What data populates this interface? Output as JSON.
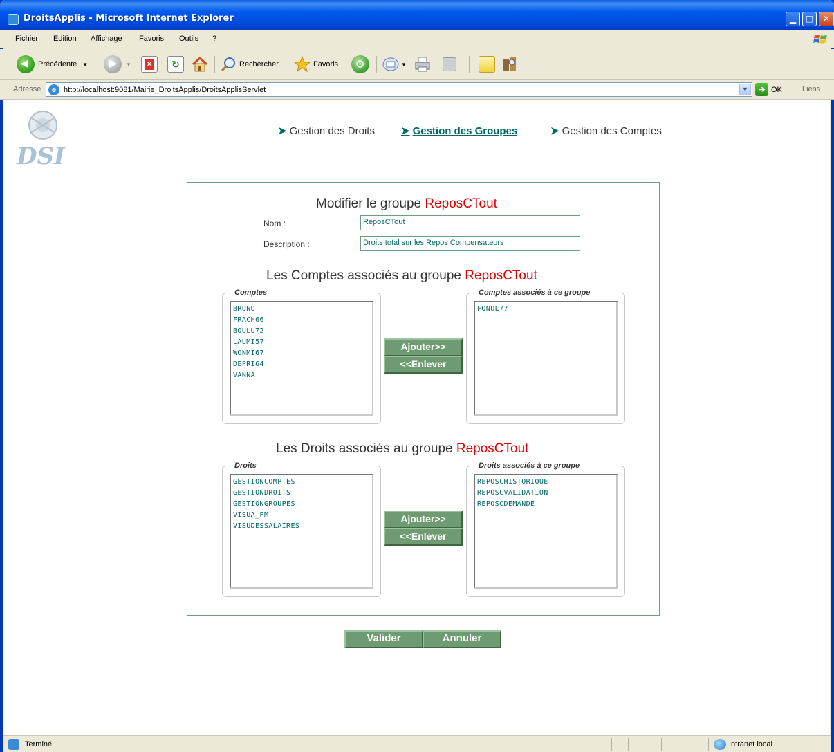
{
  "window": {
    "title": "DroitsApplis - Microsoft Internet Explorer"
  },
  "menu": {
    "items": [
      "Fichier",
      "Edition",
      "Affichage",
      "Favoris",
      "Outils",
      "?"
    ]
  },
  "toolbar": {
    "back_label": "Précédente",
    "search_label": "Rechercher",
    "favorites_label": "Favoris"
  },
  "address": {
    "label": "Adresse",
    "url": "http://localhost:9081/Mairie_DroitsApplis/DroitsApplisServlet",
    "go_label": "OK",
    "links_label": "Liens"
  },
  "logo": {
    "text": "DSI"
  },
  "nav": {
    "droits": "Gestion des Droits",
    "groupes": "Gestion des Groupes",
    "comptes": "Gestion des Comptes",
    "active": "groupes"
  },
  "form": {
    "title_prefix": "Modifier le groupe",
    "group_name": "ReposCTout",
    "nom_label": "Nom :",
    "nom_value": "ReposCTout",
    "description_label": "Description :",
    "description_value": "Droits total sur les Repos Compensateurs"
  },
  "comptes_section": {
    "heading_prefix": "Les Comptes associés au groupe",
    "group_name": "ReposCTout",
    "available_legend": "Comptes",
    "available": [
      "BRUNO",
      "FRACH66",
      "BOULU72",
      "LAUMI57",
      "WONMI67",
      "DEPRI64",
      "VANNA"
    ],
    "assigned_legend": "Comptes associés à ce groupe",
    "assigned": [
      "FONOL77"
    ],
    "add_label": "Ajouter>>",
    "remove_label": "<<Enlever"
  },
  "droits_section": {
    "heading_prefix": "Les Droits associés au groupe",
    "group_name": "ReposCTout",
    "available_legend": "Droits",
    "available": [
      "GESTIONCOMPTES",
      "GESTIONDROITS",
      "GESTIONGROUPES",
      "VISUA_PM",
      "VISUDESSALAIRES"
    ],
    "assigned_legend": "Droits associés à ce groupe",
    "assigned": [
      "REPOSCHISTORIQUE",
      "REPOSCVALIDATION",
      "REPOSCDEMANDE"
    ],
    "add_label": "Ajouter>>",
    "remove_label": "<<Enlever"
  },
  "actions": {
    "validate": "Valider",
    "cancel": "Annuler"
  },
  "status": {
    "text": "Terminé",
    "zone": "Intranet local"
  },
  "colors": {
    "accent_teal": "#006666",
    "group_red": "#dd0000",
    "button_green": "#6f9b72",
    "border_green": "#6e9d7f"
  }
}
